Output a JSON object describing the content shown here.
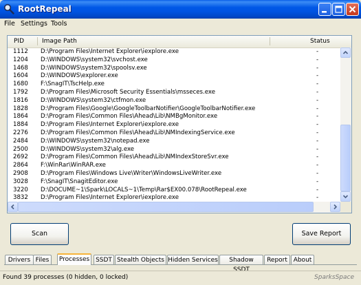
{
  "window": {
    "title": "RootRepeal"
  },
  "menu": [
    "File",
    "Settings",
    "Tools"
  ],
  "table": {
    "columns": {
      "pid": "PID",
      "path": "Image Path",
      "status": "Status"
    },
    "rows": [
      {
        "pid": "1112",
        "path": "D:\\Program Files\\Internet Explorer\\iexplore.exe",
        "status": "-"
      },
      {
        "pid": "1204",
        "path": "D:\\WINDOWS\\system32\\svchost.exe",
        "status": "-"
      },
      {
        "pid": "1468",
        "path": "D:\\WINDOWS\\system32\\spoolsv.exe",
        "status": "-"
      },
      {
        "pid": "1604",
        "path": "D:\\WINDOWS\\explorer.exe",
        "status": "-"
      },
      {
        "pid": "1680",
        "path": "F:\\SnagIT\\TscHelp.exe",
        "status": "-"
      },
      {
        "pid": "1792",
        "path": "D:\\Program Files\\Microsoft Security Essentials\\msseces.exe",
        "status": "-"
      },
      {
        "pid": "1816",
        "path": "D:\\WINDOWS\\system32\\ctfmon.exe",
        "status": "-"
      },
      {
        "pid": "1828",
        "path": "D:\\Program Files\\Google\\GoogleToolbarNotifier\\GoogleToolbarNotifier.exe",
        "status": "-"
      },
      {
        "pid": "1864",
        "path": "D:\\Program Files\\Common Files\\Ahead\\Lib\\NMBgMonitor.exe",
        "status": "-"
      },
      {
        "pid": "1884",
        "path": "D:\\Program Files\\Internet Explorer\\iexplore.exe",
        "status": "-"
      },
      {
        "pid": "2276",
        "path": "D:\\Program Files\\Common Files\\Ahead\\Lib\\NMIndexingService.exe",
        "status": "-"
      },
      {
        "pid": "2484",
        "path": "D:\\WINDOWS\\system32\\notepad.exe",
        "status": "-"
      },
      {
        "pid": "2500",
        "path": "D:\\WINDOWS\\system32\\alg.exe",
        "status": "-"
      },
      {
        "pid": "2692",
        "path": "D:\\Program Files\\Common Files\\Ahead\\Lib\\NMIndexStoreSvr.exe",
        "status": "-"
      },
      {
        "pid": "2864",
        "path": "F:\\WinRar\\WinRAR.exe",
        "status": "-"
      },
      {
        "pid": "2908",
        "path": "D:\\Program Files\\Windows Live\\Writer\\WindowsLiveWriter.exe",
        "status": "-"
      },
      {
        "pid": "3028",
        "path": "F:\\SnagIT\\SnagitEditor.exe",
        "status": "-"
      },
      {
        "pid": "3220",
        "path": "D:\\DOCUME~1\\Spark\\LOCALS~1\\Temp\\Rar$EX00.078\\RootRepeal.exe",
        "status": "-"
      },
      {
        "pid": "3832",
        "path": "D:\\Program Files\\Internet Explorer\\iexplore.exe",
        "status": "-"
      }
    ]
  },
  "buttons": {
    "scan": "Scan",
    "save_report": "Save Report"
  },
  "tabs": [
    "Drivers",
    "Files",
    "Processes",
    "SSDT",
    "Stealth Objects",
    "Hidden Services",
    "Shadow SSDT",
    "Report",
    "About"
  ],
  "active_tab": "Processes",
  "status": {
    "text": "Found 39 processes (0 hidden, 0 locked)",
    "watermark": "SparksSpace"
  },
  "colors": {
    "titlebar": "#0054e3",
    "window_bg": "#ece9d8",
    "active_tab_accent": "#f7b339"
  },
  "icons": [
    "magnifier-app-icon",
    "minimize-icon",
    "maximize-icon",
    "close-icon",
    "scroll-up-icon",
    "scroll-down-icon",
    "scroll-left-icon",
    "scroll-right-icon"
  ]
}
